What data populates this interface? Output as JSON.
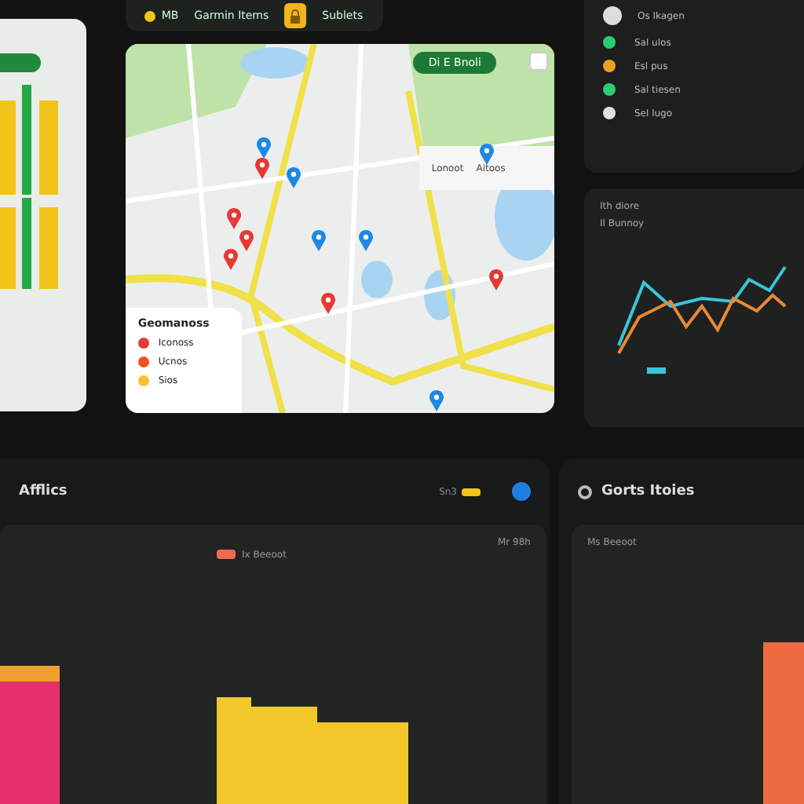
{
  "header": {
    "status": "MB",
    "title": "Garmin Items",
    "action": "Sublets"
  },
  "map": {
    "button": "Di E Bnoli",
    "search_tabs": [
      "Lonoot",
      "Aitoos"
    ],
    "pins": [
      {
        "color": "#1e88e5"
      },
      {
        "color": "#e53935"
      },
      {
        "color": "#1e88e5"
      },
      {
        "color": "#e53935"
      },
      {
        "color": "#e53935"
      },
      {
        "color": "#e53935"
      },
      {
        "color": "#1e88e5"
      },
      {
        "color": "#1e88e5"
      },
      {
        "color": "#1e88e5"
      },
      {
        "color": "#e53935"
      },
      {
        "color": "#1e88e5"
      },
      {
        "color": "#e53935"
      }
    ],
    "legend": {
      "title": "Geomanoss",
      "items": [
        {
          "label": "Iconoss",
          "color": "#e53935"
        },
        {
          "label": "Ucnos",
          "color": "#f4511e"
        },
        {
          "label": "Sios",
          "color": "#fbc02d"
        }
      ]
    }
  },
  "status": {
    "title": "Os Ikagen",
    "items": [
      {
        "label": "Sal ulos",
        "color": "#2ecc71"
      },
      {
        "label": "Esl pus",
        "color": "#f0a020"
      },
      {
        "label": "Sal tiesen",
        "color": "#2ecc71"
      },
      {
        "label": "Sel lugo",
        "color": "#e0e0e0"
      }
    ]
  },
  "trend": {
    "title": "Ith diore",
    "subtitle": "Il Bunnoy"
  },
  "analytics": {
    "title": "Afflics",
    "badge": "Sn3",
    "range": "Mr 98h",
    "legend": "Ix Beeoot"
  },
  "goals": {
    "title": "Gorts Itoies",
    "subtitle": "Ms Beeoot"
  }
}
